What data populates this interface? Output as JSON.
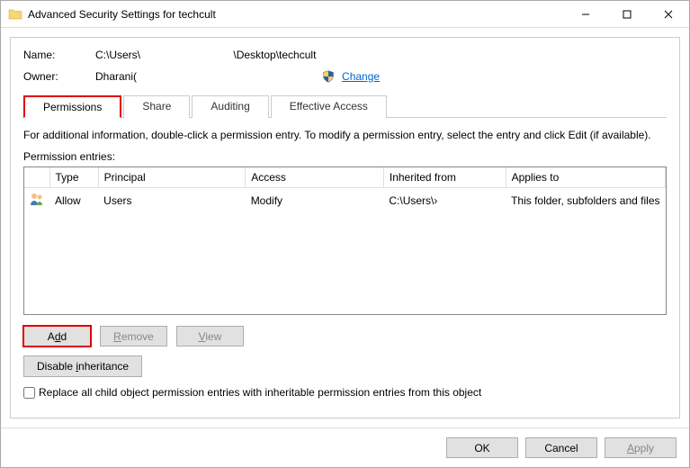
{
  "titlebar": {
    "title": "Advanced Security Settings for techcult"
  },
  "info": {
    "name_label": "Name:",
    "name_value": "C:\\Users\\                               \\Desktop\\techcult",
    "owner_label": "Owner:",
    "owner_value": "Dharani(",
    "change_link": "Change"
  },
  "tabs": [
    {
      "label": "Permissions",
      "active": true
    },
    {
      "label": "Share",
      "active": false
    },
    {
      "label": "Auditing",
      "active": false
    },
    {
      "label": "Effective Access",
      "active": false
    }
  ],
  "desc": "For additional information, double-click a permission entry. To modify a permission entry, select the entry and click Edit (if available).",
  "entries_label": "Permission entries:",
  "columns": {
    "type": "Type",
    "principal": "Principal",
    "access": "Access",
    "inherited": "Inherited from",
    "applies": "Applies to"
  },
  "rows": [
    {
      "type": "Allow",
      "principal": "Users",
      "access": "Modify",
      "inherited": "C:\\Users\\›",
      "applies": "This folder, subfolders and files"
    }
  ],
  "buttons": {
    "add": "Add",
    "remove": "Remove",
    "view": "View",
    "disable_inheritance": "Disable inheritance",
    "ok": "OK",
    "cancel": "Cancel",
    "apply": "Apply"
  },
  "checkbox_label": "Replace all child object permission entries with inheritable permission entries from this object"
}
